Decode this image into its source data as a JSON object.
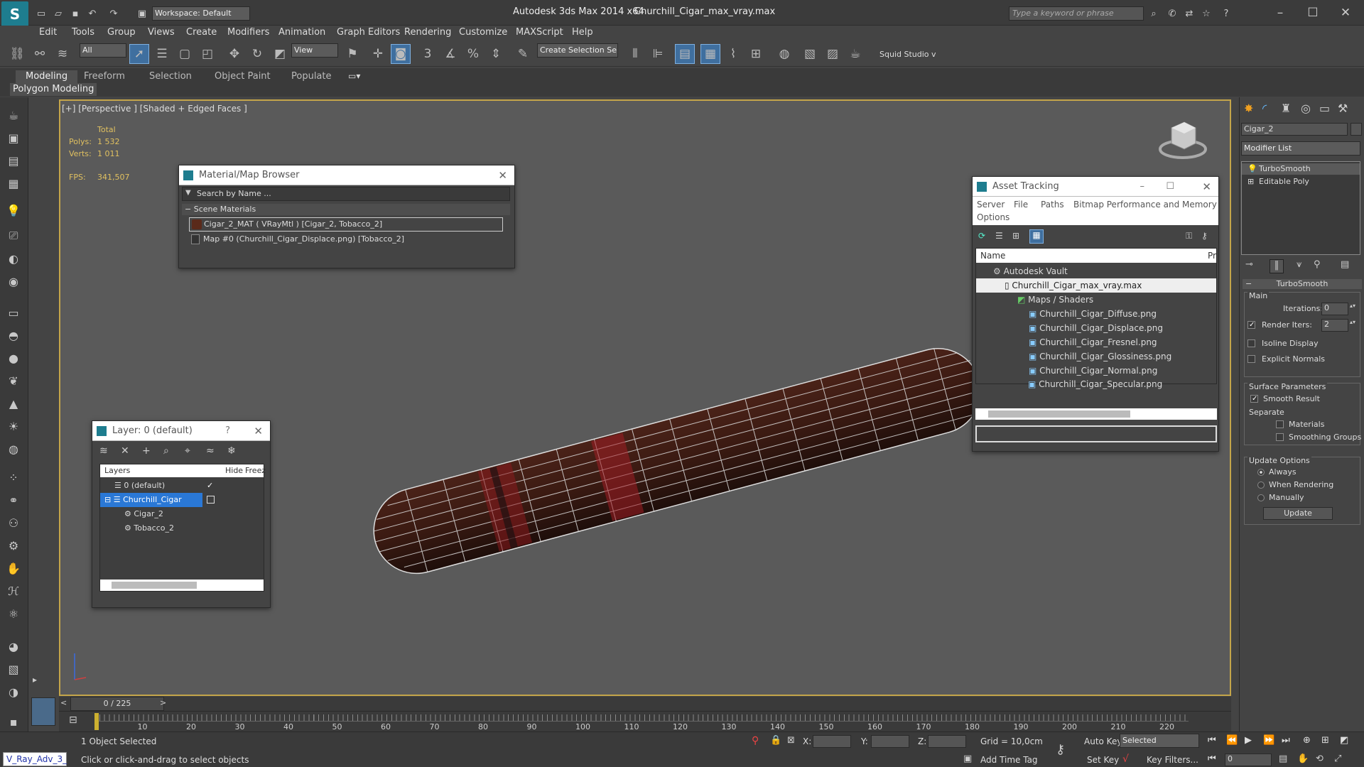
{
  "title": {
    "app": "Autodesk 3ds Max  2014 x64",
    "file": "Churchill_Cigar_max_vray.max",
    "workspace": "Workspace: Default",
    "search_placeholder": "Type a keyword or phrase"
  },
  "menu": [
    "Edit",
    "Tools",
    "Group",
    "Views",
    "Create",
    "Modifiers",
    "Animation",
    "Graph Editors",
    "Rendering",
    "Customize",
    "MAXScript",
    "Help"
  ],
  "toolbar": {
    "filter": "All",
    "ref_coord": "View",
    "selection_set": "Create Selection Se",
    "squid": "Squid Studio v"
  },
  "ribbon": {
    "tabs": [
      "Modeling",
      "Freeform",
      "Selection",
      "Object Paint",
      "Populate"
    ],
    "sub": "Polygon Modeling"
  },
  "viewport": {
    "label": "[+] [Perspective ] [Shaded + Edged Faces ]",
    "total": "Total",
    "polys_label": "Polys:",
    "polys": "1 532",
    "verts_label": "Verts:",
    "verts": "1 011",
    "fps_label": "FPS:",
    "fps": "341,507"
  },
  "material_browser": {
    "title": "Material/Map Browser",
    "search": "Search by Name ...",
    "section": "Scene Materials",
    "items": [
      "Cigar_2_MAT ( VRayMtl ) [Cigar_2, Tobacco_2]",
      "Map #0 (Churchill_Cigar_Displace.png) [Tobacco_2]"
    ]
  },
  "layer_panel": {
    "title": "Layer: 0 (default)",
    "help": "?",
    "col_layers": "Layers",
    "col_hide": "Hide",
    "col_freeze": "Freez",
    "rows": [
      "0 (default)",
      "Churchill_Cigar",
      "Cigar_2",
      "Tobacco_2"
    ]
  },
  "asset_tracking": {
    "title": "Asset Tracking",
    "menu": [
      "Server",
      "File",
      "Paths",
      "Bitmap Performance and Memory",
      "Options"
    ],
    "col_name": "Name",
    "col_pr": "Pr",
    "vault": "Autodesk Vault",
    "file": "Churchill_Cigar_max_vray.max",
    "folder": "Maps / Shaders",
    "maps": [
      "Churchill_Cigar_Diffuse.png",
      "Churchill_Cigar_Displace.png",
      "Churchill_Cigar_Fresnel.png",
      "Churchill_Cigar_Glossiness.png",
      "Churchill_Cigar_Normal.png",
      "Churchill_Cigar_Specular.png"
    ]
  },
  "command_panel": {
    "object_name": "Cigar_2",
    "modifier_list": "Modifier List",
    "stack": [
      "TurboSmooth",
      "Editable Poly"
    ],
    "rollout": "TurboSmooth",
    "main": "Main",
    "iterations_label": "Iterations:",
    "iterations": "0",
    "render_iters_label": "Render Iters:",
    "render_iters": "2",
    "isoline": "Isoline Display",
    "explicit": "Explicit Normals",
    "surface": "Surface Parameters",
    "smooth_result": "Smooth Result",
    "separate": "Separate",
    "materials": "Materials",
    "smoothing_groups": "Smoothing Groups",
    "update_options": "Update Options",
    "always": "Always",
    "when_rendering": "When Rendering",
    "manually": "Manually",
    "update_btn": "Update"
  },
  "timeline": {
    "frame": "0 / 225",
    "ticks": [
      "10",
      "20",
      "30",
      "40",
      "50",
      "60",
      "70",
      "80",
      "90",
      "100",
      "110",
      "120",
      "130",
      "140",
      "150",
      "160",
      "170",
      "180",
      "190",
      "200",
      "210",
      "220"
    ]
  },
  "status": {
    "selected": "1 Object Selected",
    "prompt": "Click or click-and-drag to select objects",
    "x": "X:",
    "y": "Y:",
    "z": "Z:",
    "grid": "Grid = 10,0cm",
    "add_time_tag": "Add Time Tag",
    "auto_key": "Auto Key",
    "set_key": "Set Key",
    "key_mode": "Selected",
    "key_filters": "Key Filters...",
    "frame_field": "0",
    "script_tab": "V_Ray_Adv_3_"
  }
}
